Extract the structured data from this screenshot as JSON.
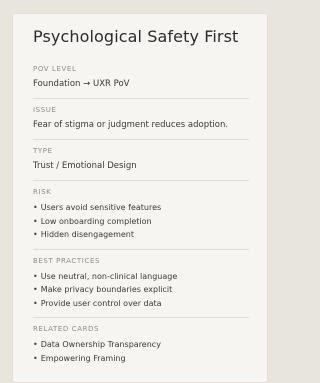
{
  "card": {
    "title": "Psychological Safety First",
    "pov": {
      "label": "POV LEVEL",
      "value": "Foundation → UXR PoV"
    },
    "issue": {
      "label": "ISSUE",
      "value": "Fear of stigma or judgment reduces adoption."
    },
    "type": {
      "label": "TYPE",
      "value": "Trust / Emotional Design"
    },
    "risk": {
      "label": "RISK",
      "items": [
        "Users avoid sensitive features",
        "Low onboarding completion",
        "Hidden disengagement"
      ]
    },
    "best_practices": {
      "label": "BEST PRACTICES",
      "items": [
        "Use neutral, non-clinical language",
        "Make privacy boundaries explicit",
        "Provide user control over data"
      ]
    },
    "related": {
      "label": "RELATED CARDS",
      "items": [
        "Data Ownership Transparency",
        "Empowering Framing"
      ]
    }
  }
}
